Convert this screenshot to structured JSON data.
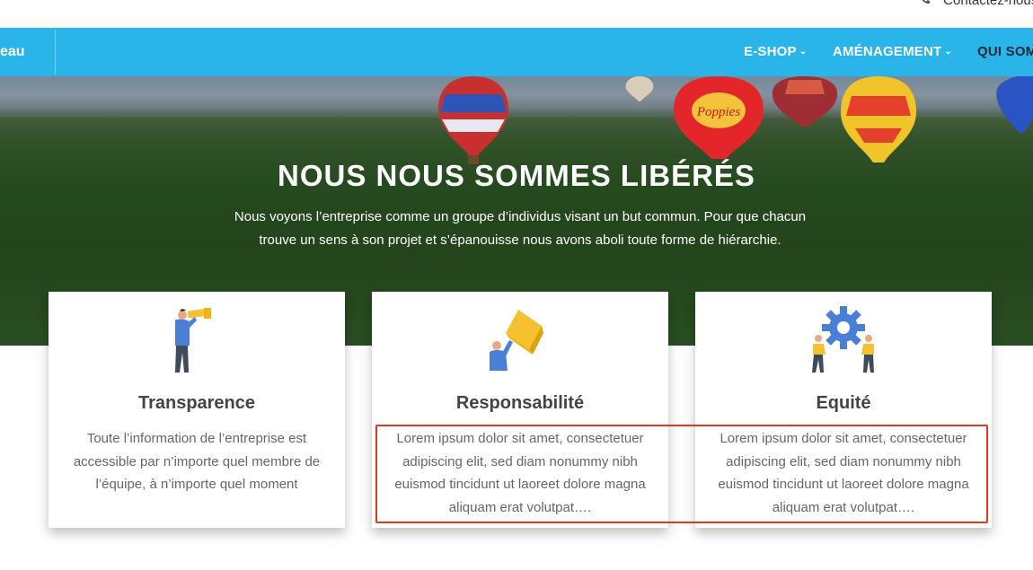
{
  "topbar": {
    "contact_text": "Contactez-nous"
  },
  "navbar": {
    "brand_fragment": "eau",
    "items": [
      {
        "label": "E-SHOP"
      },
      {
        "label": "AMÉNAGEMENT"
      },
      {
        "label": "QUI SOM"
      }
    ]
  },
  "hero": {
    "title": "NOUS NOUS SOMMES LIBÉRÉS",
    "subtitle": "Nous voyons l’entreprise comme un groupe d’individus visant un but commun. Pour que chacun trouve un sens à son projet et s’épanouisse nous avons aboli toute forme de hiérarchie."
  },
  "cards": [
    {
      "icon": "telescope-person-icon",
      "title": "Transparence",
      "text": "Toute l’information de l’entreprise est accessible par n’importe quel membre de l’équipe, à n’importe quel moment"
    },
    {
      "icon": "person-carrying-box-icon",
      "title": "Responsabilité",
      "text": "Lorem ipsum dolor sit amet, consectetuer adipiscing elit, sed diam nonummy nibh euismod tincidunt ut laoreet dolore magna aliquam erat volutpat…."
    },
    {
      "icon": "people-gear-icon",
      "title": "Equité",
      "text": "Lorem ipsum dolor sit amet, consectetuer adipiscing elit, sed diam nonummy nibh euismod tincidunt ut laoreet dolore magna aliquam erat volutpat…."
    }
  ],
  "colors": {
    "nav_bg": "#29b5ea",
    "highlight": "#e0391f",
    "icon_blue": "#4a7fd8",
    "icon_yellow": "#f6c12e"
  }
}
